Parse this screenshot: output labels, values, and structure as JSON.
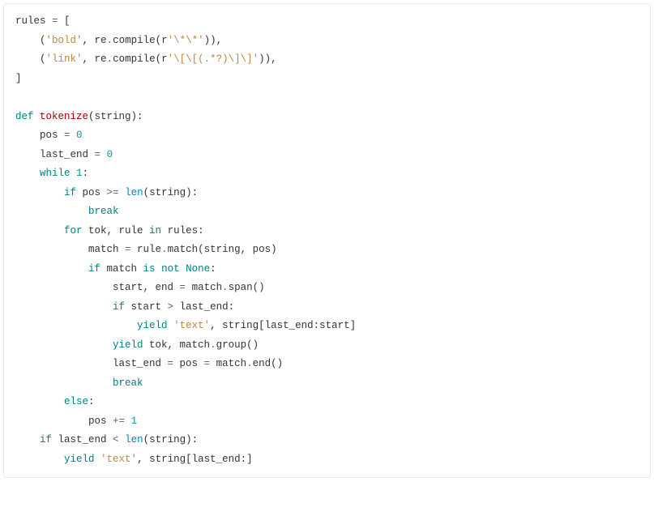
{
  "code": {
    "colors": {
      "text": "#333333",
      "name": "#333333",
      "operator": "#666666",
      "punct": "#333333",
      "string": "#bb8844",
      "keyword": "#008080",
      "kwblue": "#0086b3",
      "def": "#990000",
      "fn": "#990000",
      "builtin": "#0086b3",
      "number": "#009999",
      "none": "#008080",
      "yield": "#008080"
    },
    "tokens": [
      {
        "t": "rules ",
        "c": "text"
      },
      {
        "t": "=",
        "c": "operator"
      },
      {
        "t": " [",
        "c": "punct"
      },
      {
        "t": "\n",
        "c": "text"
      },
      {
        "t": "    (",
        "c": "punct"
      },
      {
        "t": "'bold'",
        "c": "string"
      },
      {
        "t": ", re",
        "c": "text"
      },
      {
        "t": ".",
        "c": "operator"
      },
      {
        "t": "compile(r",
        "c": "text"
      },
      {
        "t": "'\\*\\*'",
        "c": "string"
      },
      {
        "t": ")),",
        "c": "punct"
      },
      {
        "t": "\n",
        "c": "text"
      },
      {
        "t": "    (",
        "c": "punct"
      },
      {
        "t": "'link'",
        "c": "string"
      },
      {
        "t": ", re",
        "c": "text"
      },
      {
        "t": ".",
        "c": "operator"
      },
      {
        "t": "compile(r",
        "c": "text"
      },
      {
        "t": "'\\[\\[(.*?)\\]\\]'",
        "c": "string"
      },
      {
        "t": ")),",
        "c": "punct"
      },
      {
        "t": "\n",
        "c": "text"
      },
      {
        "t": "]",
        "c": "punct"
      },
      {
        "t": "\n",
        "c": "text"
      },
      {
        "t": "\n",
        "c": "text"
      },
      {
        "t": "def",
        "c": "keyword"
      },
      {
        "t": " ",
        "c": "text"
      },
      {
        "t": "tokenize",
        "c": "fn"
      },
      {
        "t": "(string):",
        "c": "punct"
      },
      {
        "t": "\n",
        "c": "text"
      },
      {
        "t": "    pos ",
        "c": "text"
      },
      {
        "t": "=",
        "c": "operator"
      },
      {
        "t": " ",
        "c": "text"
      },
      {
        "t": "0",
        "c": "number"
      },
      {
        "t": "\n",
        "c": "text"
      },
      {
        "t": "    last_end ",
        "c": "text"
      },
      {
        "t": "=",
        "c": "operator"
      },
      {
        "t": " ",
        "c": "text"
      },
      {
        "t": "0",
        "c": "number"
      },
      {
        "t": "\n",
        "c": "text"
      },
      {
        "t": "    ",
        "c": "text"
      },
      {
        "t": "while",
        "c": "keyword"
      },
      {
        "t": " ",
        "c": "text"
      },
      {
        "t": "1",
        "c": "number"
      },
      {
        "t": ":",
        "c": "punct"
      },
      {
        "t": "\n",
        "c": "text"
      },
      {
        "t": "        ",
        "c": "text"
      },
      {
        "t": "if",
        "c": "keyword"
      },
      {
        "t": " pos ",
        "c": "text"
      },
      {
        "t": ">=",
        "c": "operator"
      },
      {
        "t": " ",
        "c": "text"
      },
      {
        "t": "len",
        "c": "builtin"
      },
      {
        "t": "(string):",
        "c": "punct"
      },
      {
        "t": "\n",
        "c": "text"
      },
      {
        "t": "            ",
        "c": "text"
      },
      {
        "t": "break",
        "c": "keyword"
      },
      {
        "t": "\n",
        "c": "text"
      },
      {
        "t": "        ",
        "c": "text"
      },
      {
        "t": "for",
        "c": "keyword"
      },
      {
        "t": " tok, rule ",
        "c": "text"
      },
      {
        "t": "in",
        "c": "keyword"
      },
      {
        "t": " rules:",
        "c": "text"
      },
      {
        "t": "\n",
        "c": "text"
      },
      {
        "t": "            match ",
        "c": "text"
      },
      {
        "t": "=",
        "c": "operator"
      },
      {
        "t": " rule",
        "c": "text"
      },
      {
        "t": ".",
        "c": "operator"
      },
      {
        "t": "match(string, pos)",
        "c": "text"
      },
      {
        "t": "\n",
        "c": "text"
      },
      {
        "t": "            ",
        "c": "text"
      },
      {
        "t": "if",
        "c": "keyword"
      },
      {
        "t": " match ",
        "c": "text"
      },
      {
        "t": "is",
        "c": "keyword"
      },
      {
        "t": " ",
        "c": "text"
      },
      {
        "t": "not",
        "c": "keyword"
      },
      {
        "t": " ",
        "c": "text"
      },
      {
        "t": "None",
        "c": "none"
      },
      {
        "t": ":",
        "c": "punct"
      },
      {
        "t": "\n",
        "c": "text"
      },
      {
        "t": "                start, end ",
        "c": "text"
      },
      {
        "t": "=",
        "c": "operator"
      },
      {
        "t": " match",
        "c": "text"
      },
      {
        "t": ".",
        "c": "operator"
      },
      {
        "t": "span()",
        "c": "text"
      },
      {
        "t": "\n",
        "c": "text"
      },
      {
        "t": "                ",
        "c": "text"
      },
      {
        "t": "if",
        "c": "keyword"
      },
      {
        "t": " start ",
        "c": "text"
      },
      {
        "t": ">",
        "c": "operator"
      },
      {
        "t": " last_end:",
        "c": "text"
      },
      {
        "t": "\n",
        "c": "text"
      },
      {
        "t": "                    ",
        "c": "text"
      },
      {
        "t": "yield",
        "c": "yield"
      },
      {
        "t": " ",
        "c": "text"
      },
      {
        "t": "'text'",
        "c": "string"
      },
      {
        "t": ", string[last_end:start]",
        "c": "text"
      },
      {
        "t": "\n",
        "c": "text"
      },
      {
        "t": "                ",
        "c": "text"
      },
      {
        "t": "yield",
        "c": "yield"
      },
      {
        "t": " tok, match",
        "c": "text"
      },
      {
        "t": ".",
        "c": "operator"
      },
      {
        "t": "group()",
        "c": "text"
      },
      {
        "t": "\n",
        "c": "text"
      },
      {
        "t": "                last_end ",
        "c": "text"
      },
      {
        "t": "=",
        "c": "operator"
      },
      {
        "t": " pos ",
        "c": "text"
      },
      {
        "t": "=",
        "c": "operator"
      },
      {
        "t": " match",
        "c": "text"
      },
      {
        "t": ".",
        "c": "operator"
      },
      {
        "t": "end()",
        "c": "text"
      },
      {
        "t": "\n",
        "c": "text"
      },
      {
        "t": "                ",
        "c": "text"
      },
      {
        "t": "break",
        "c": "keyword"
      },
      {
        "t": "\n",
        "c": "text"
      },
      {
        "t": "        ",
        "c": "text"
      },
      {
        "t": "else",
        "c": "keyword"
      },
      {
        "t": ":",
        "c": "punct"
      },
      {
        "t": "\n",
        "c": "text"
      },
      {
        "t": "            pos ",
        "c": "text"
      },
      {
        "t": "+=",
        "c": "operator"
      },
      {
        "t": " ",
        "c": "text"
      },
      {
        "t": "1",
        "c": "number"
      },
      {
        "t": "\n",
        "c": "text"
      },
      {
        "t": "    ",
        "c": "text"
      },
      {
        "t": "if",
        "c": "keyword"
      },
      {
        "t": " last_end ",
        "c": "text"
      },
      {
        "t": "<",
        "c": "operator"
      },
      {
        "t": " ",
        "c": "text"
      },
      {
        "t": "len",
        "c": "builtin"
      },
      {
        "t": "(string):",
        "c": "punct"
      },
      {
        "t": "\n",
        "c": "text"
      },
      {
        "t": "        ",
        "c": "text"
      },
      {
        "t": "yield",
        "c": "yield"
      },
      {
        "t": " ",
        "c": "text"
      },
      {
        "t": "'text'",
        "c": "string"
      },
      {
        "t": ", string[last_end:]",
        "c": "text"
      }
    ]
  }
}
